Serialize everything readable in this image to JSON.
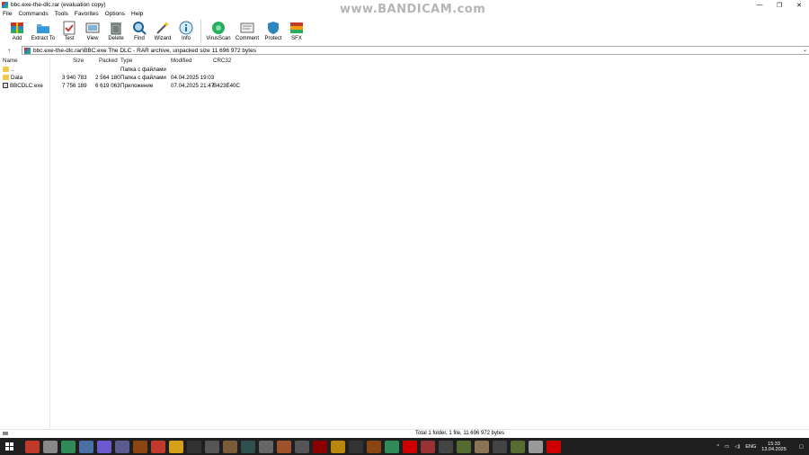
{
  "window": {
    "title": "bbc.exe-the-dlc.rar (evaluation copy)",
    "controls": {
      "minimize": "—",
      "maximize": "❐",
      "close": "✕"
    }
  },
  "watermark": "www.BANDICAM.com",
  "menu": [
    "File",
    "Commands",
    "Tools",
    "Favorites",
    "Options",
    "Help"
  ],
  "toolbar": [
    {
      "label": "Add",
      "icon": "add-archive-icon"
    },
    {
      "label": "Extract To",
      "icon": "extract-folder-icon"
    },
    {
      "label": "Test",
      "icon": "test-clipboard-icon"
    },
    {
      "label": "View",
      "icon": "view-book-icon"
    },
    {
      "label": "Delete",
      "icon": "trash-icon"
    },
    {
      "label": "Find",
      "icon": "magnifier-icon"
    },
    {
      "label": "Wizard",
      "icon": "wand-icon"
    },
    {
      "label": "Info",
      "icon": "info-icon"
    },
    {
      "label": "VirusScan",
      "icon": "virus-scan-icon"
    },
    {
      "label": "Comment",
      "icon": "comment-icon"
    },
    {
      "label": "Protect",
      "icon": "shield-icon"
    },
    {
      "label": "SFX",
      "icon": "sfx-icon"
    }
  ],
  "address": {
    "path": "bbc.exe-the-dlc.rar\\BBC.exe The DLC - RAR archive, unpacked size 11 696 972 bytes"
  },
  "columns": {
    "name": "Name",
    "size": "Size",
    "packed": "Packed",
    "type": "Type",
    "modified": "Modified",
    "crc": "CRC32"
  },
  "rows": [
    {
      "name": "..",
      "size": "",
      "packed": "",
      "type": "Папка с файлами",
      "modified": "",
      "crc": "",
      "kind": "folder"
    },
    {
      "name": "Data",
      "size": "3 940 783",
      "packed": "2 564 180",
      "type": "Папка с файлами",
      "modified": "04.04.2025 19:03",
      "crc": "",
      "kind": "folder"
    },
    {
      "name": "BBCDLC.exe",
      "size": "7 756 189",
      "packed": "6 619 063",
      "type": "Приложение",
      "modified": "07.04.2025 21:47",
      "crc": "B423E40C",
      "kind": "exe"
    }
  ],
  "status": {
    "text": "Total 1 folder, 1 file, 11 696 972 bytes"
  },
  "taskbar": {
    "lang": "ENG",
    "time": "15:33",
    "date": "13.04.2025",
    "app_colors": [
      "#c0392b",
      "#888888",
      "#2e8b57",
      "#4a6fa5",
      "#6a5acd",
      "#5b5b8f",
      "#8b4513",
      "#c0392b",
      "#d4a017",
      "#333333",
      "#555555",
      "#7a5c3a",
      "#2f4f4f",
      "#666666",
      "#a0522d",
      "#555555",
      "#8b0000",
      "#b8860b",
      "#333333",
      "#8b4513",
      "#2e8b57",
      "#cc0000",
      "#993333",
      "#444444",
      "#556b2f",
      "#8b7355",
      "#444444",
      "#556b2f",
      "#999999",
      "#cc0000"
    ]
  }
}
